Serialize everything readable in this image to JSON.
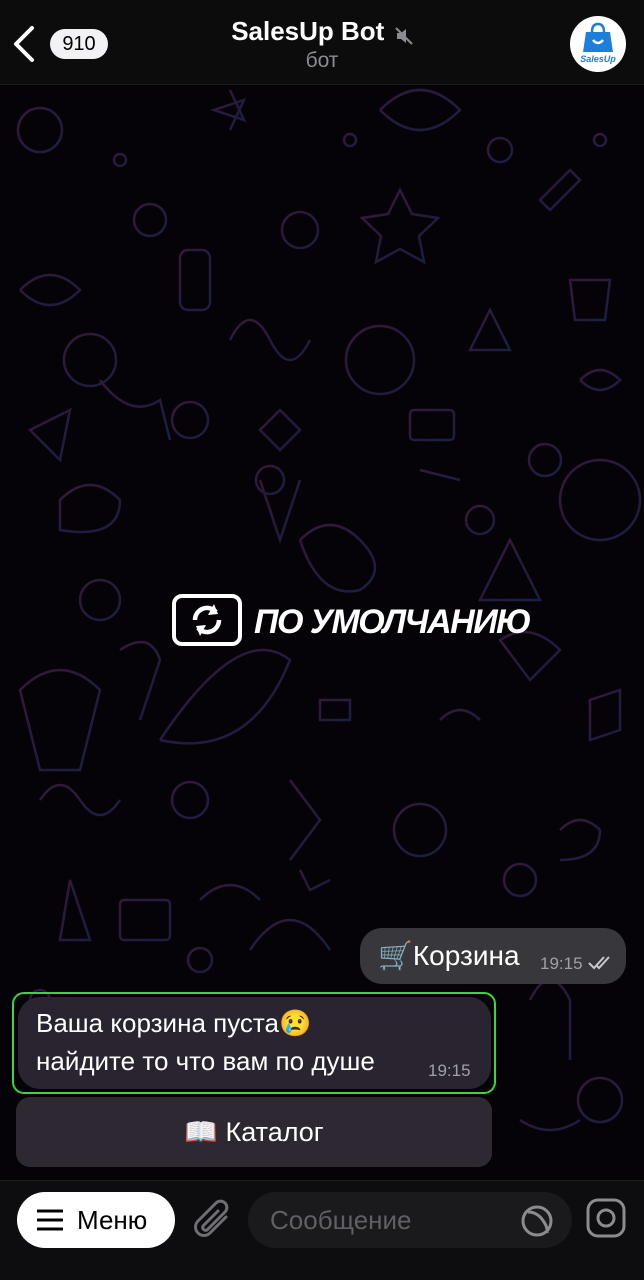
{
  "header": {
    "back_count": "910",
    "title": "SalesUp Bot",
    "subtitle": "бот",
    "avatar_label": "SalesUp"
  },
  "wallpaper": {
    "default_label": "ПО УМОЛЧАНИЮ"
  },
  "messages": [
    {
      "direction": "outgoing",
      "emoji": "🛒",
      "text": "Корзина",
      "time": "19:15",
      "status": "read"
    },
    {
      "direction": "incoming",
      "line1": "Ваша корзина пуста😢",
      "line2": "найдите то что вам по душе",
      "time": "19:15"
    }
  ],
  "keyboard": {
    "catalog_button": "📖 Каталог"
  },
  "composer": {
    "menu_label": "Меню",
    "placeholder": "Сообщение"
  },
  "colors": {
    "highlight": "#3bd63a",
    "outgoing_bubble": "#38383c",
    "incoming_bubble": "#2a2430",
    "brand_blue": "#1d7fd9"
  }
}
